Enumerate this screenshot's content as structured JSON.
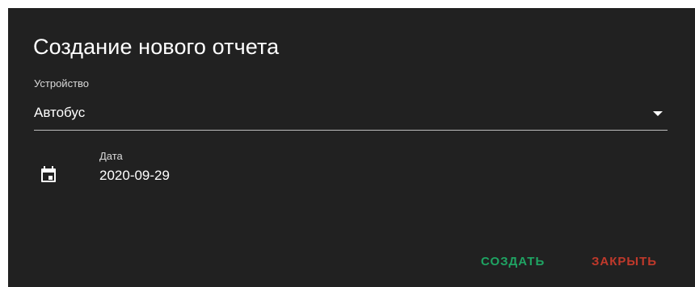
{
  "dialog": {
    "title": "Создание нового отчета",
    "device_field": {
      "label": "Устройство",
      "value": "Автобус",
      "icon": "dropdown-arrow-icon"
    },
    "date_field": {
      "label": "Дата",
      "value": "2020-09-29",
      "icon": "calendar-icon"
    },
    "actions": {
      "create_label": "СОЗДАТЬ",
      "close_label": "ЗАКРЫТЬ"
    }
  },
  "colors": {
    "dialog_background": "#212121",
    "text_primary": "#ffffff",
    "text_label": "#d9d9d9",
    "create_button": "#1fa463",
    "close_button": "#c0392b",
    "underline": "#bdbdbd"
  }
}
